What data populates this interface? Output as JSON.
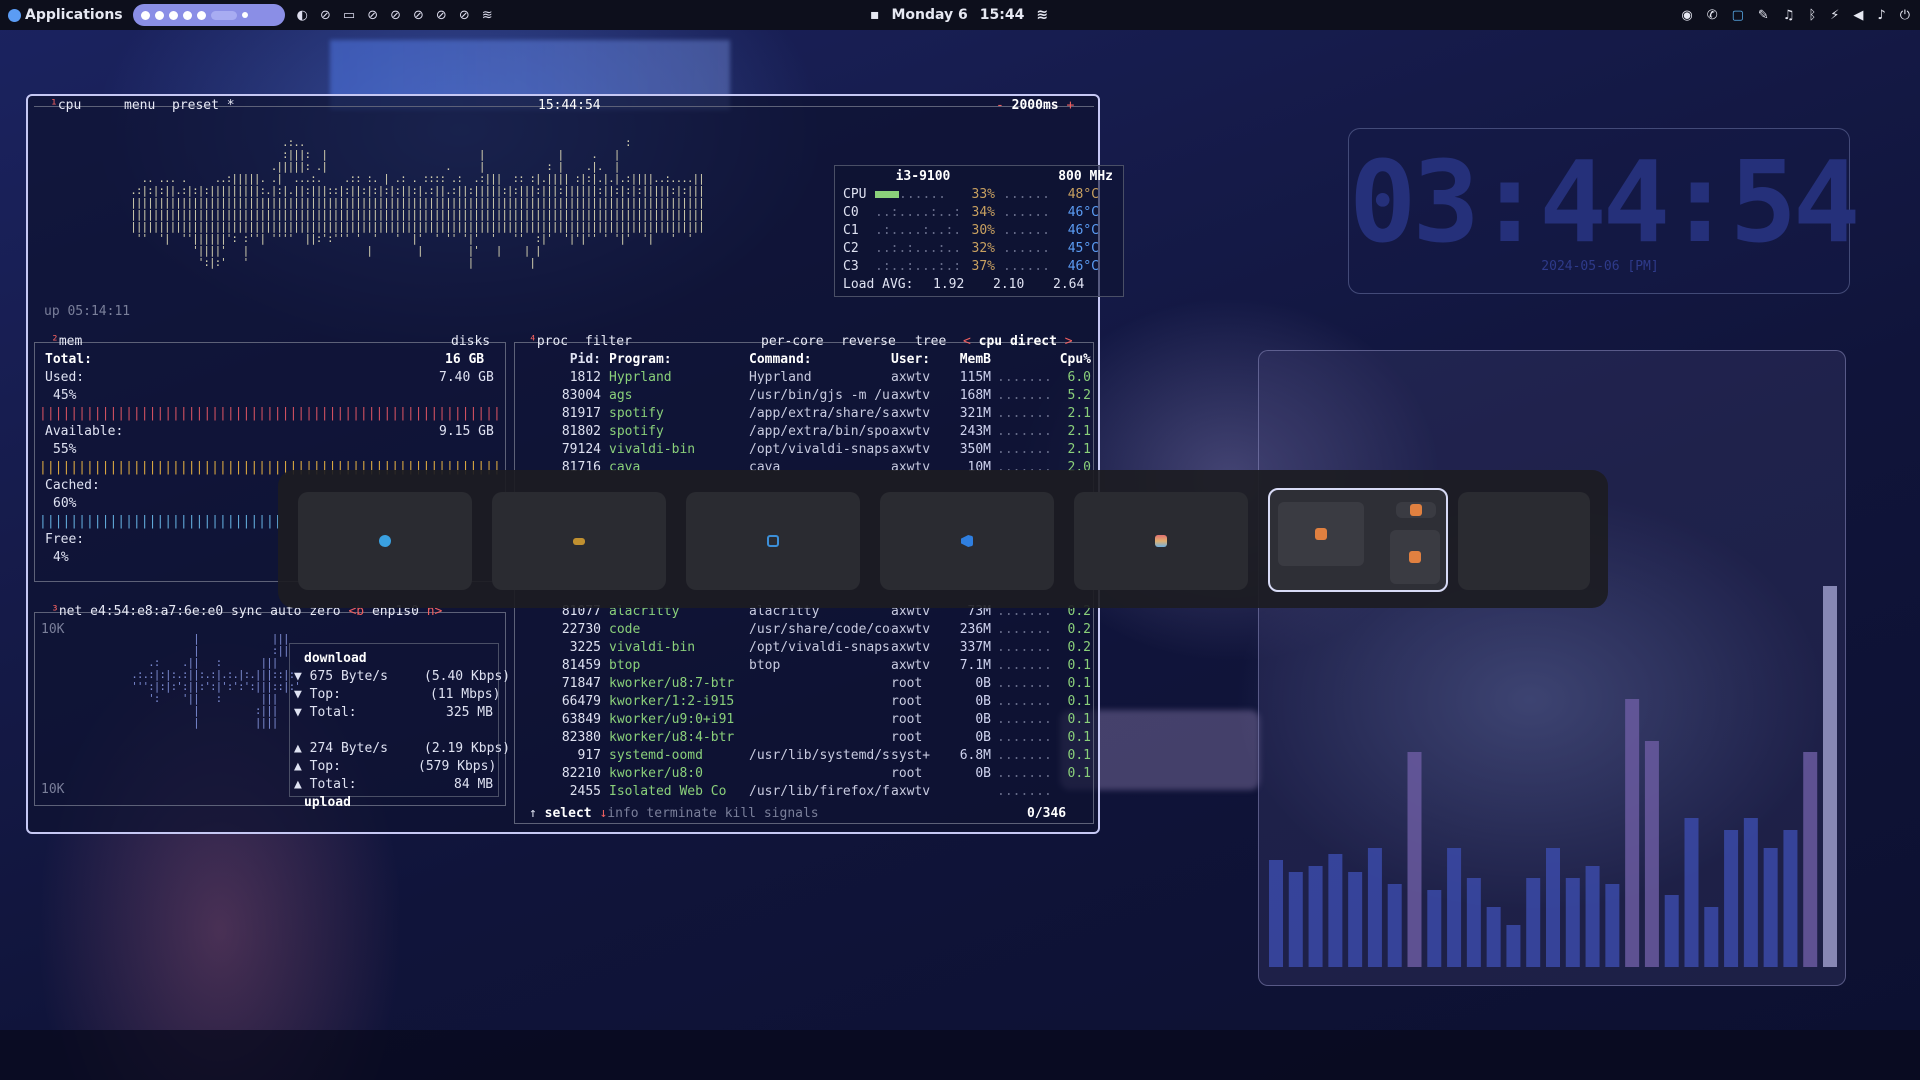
{
  "topbar": {
    "apps_label": "Applications",
    "date": "Monday  6",
    "time": "15:44"
  },
  "btop": {
    "cpu_title": "cpu",
    "cpu_num": "¹",
    "menu": "menu",
    "preset": "preset *",
    "clock": "15:44:54",
    "interval": "2000ms",
    "interval_minus": "-",
    "interval_plus": "+",
    "uptime": "up 05:14:11",
    "cpu_model": "i3-9100",
    "cpu_freq": "800 MHz",
    "cores": [
      {
        "name": "CPU",
        "pct": "33%",
        "temp": "48°C"
      },
      {
        "name": "C0",
        "pct": "34%",
        "temp": "46°C"
      },
      {
        "name": "C1",
        "pct": "30%",
        "temp": "46°C"
      },
      {
        "name": "C2",
        "pct": "32%",
        "temp": "45°C"
      },
      {
        "name": "C3",
        "pct": "37%",
        "temp": "46°C"
      }
    ],
    "load_label": "Load AVG:",
    "load": [
      "1.92",
      "2.10",
      "2.64"
    ],
    "mem_title": "mem",
    "mem_num": "²",
    "disks": "disks",
    "mem_total_label": "Total:",
    "mem_total": "16 GB",
    "mem_used_label": "Used:",
    "mem_used": "7.40 GB",
    "mem_used_pct": "45%",
    "mem_avail_label": "Available:",
    "mem_avail": "9.15 GB",
    "mem_avail_pct": "55%",
    "mem_cached_label": "Cached:",
    "mem_cached_pct": "60%",
    "mem_free_label": "Free:",
    "mem_free_pct": "4%",
    "net_title": "net",
    "net_num": "³",
    "net_mac": "e4:54:e8:a7:6e:e0",
    "net_sync": "sync",
    "net_auto": "auto",
    "net_zero": "zero",
    "net_b": "<b",
    "net_iface": "enp1s0",
    "net_n": "n>",
    "net_scale_top": "10K",
    "net_scale_bottom": "10K",
    "download_label": "download",
    "dl_rate": "675 Byte/s",
    "dl_rate_bits": "(5.40 Kbps)",
    "dl_top_label": "Top:",
    "dl_top": "(11 Mbps)",
    "dl_total_label": "Total:",
    "dl_total": "325 MB",
    "ul_rate": "274 Byte/s",
    "ul_rate_bits": "(2.19 Kbps)",
    "ul_top_label": "Top:",
    "ul_top": "(579 Kbps)",
    "ul_total_label": "Total:",
    "ul_total": "84 MB",
    "upload_label": "upload",
    "proc_title": "proc",
    "proc_num": "⁴",
    "filter": "filter",
    "per_core": "per-core",
    "reverse": "reverse",
    "tree": "tree",
    "sort_prev": "<",
    "sort_label": "cpu direct",
    "sort_next": ">",
    "col_pid": "Pid:",
    "col_program": "Program:",
    "col_command": "Command:",
    "col_user": "User:",
    "col_mem": "MemB",
    "col_cpu": "Cpu%",
    "procs_top": [
      {
        "pid": "1812",
        "program": "Hyprland",
        "command": "Hyprland",
        "user": "axwtv",
        "mem": "115M",
        "cpu": "6.0"
      },
      {
        "pid": "83004",
        "program": "ags",
        "command": "/usr/bin/gjs -m /usr",
        "user": "axwtv",
        "mem": "168M",
        "cpu": "5.2"
      },
      {
        "pid": "81917",
        "program": "spotify",
        "command": "/app/extra/share/spo",
        "user": "axwtv",
        "mem": "321M",
        "cpu": "2.1"
      },
      {
        "pid": "81802",
        "program": "spotify",
        "command": "/app/extra/bin/spoti",
        "user": "axwtv",
        "mem": "243M",
        "cpu": "2.1"
      },
      {
        "pid": "79124",
        "program": "vivaldi-bin",
        "command": "/opt/vivaldi-snapsho",
        "user": "axwtv",
        "mem": "350M",
        "cpu": "2.1"
      },
      {
        "pid": "81716",
        "program": "cava",
        "command": "cava",
        "user": "axwtv",
        "mem": "10M",
        "cpu": "2.0"
      }
    ],
    "procs_bottom": [
      {
        "pid": "81077",
        "program": "alacritty",
        "command": "alacritty",
        "user": "axwtv",
        "mem": "73M",
        "cpu": "0.2"
      },
      {
        "pid": "22730",
        "program": "code",
        "command": "/usr/share/code/code",
        "user": "axwtv",
        "mem": "236M",
        "cpu": "0.2"
      },
      {
        "pid": "3225",
        "program": "vivaldi-bin",
        "command": "/opt/vivaldi-snapsho",
        "user": "axwtv",
        "mem": "337M",
        "cpu": "0.2"
      },
      {
        "pid": "81459",
        "program": "btop",
        "command": "btop",
        "user": "axwtv",
        "mem": "7.1M",
        "cpu": "0.1"
      },
      {
        "pid": "71847",
        "program": "kworker/u8:7-btr",
        "command": "",
        "user": "root",
        "mem": "0B",
        "cpu": "0.1"
      },
      {
        "pid": "66479",
        "program": "kworker/1:2-i915",
        "command": "",
        "user": "root",
        "mem": "0B",
        "cpu": "0.1"
      },
      {
        "pid": "63849",
        "program": "kworker/u9:0+i91",
        "command": "",
        "user": "root",
        "mem": "0B",
        "cpu": "0.1"
      },
      {
        "pid": "82380",
        "program": "kworker/u8:4-btr",
        "command": "",
        "user": "root",
        "mem": "0B",
        "cpu": "0.1"
      },
      {
        "pid": "917",
        "program": "systemd-oomd",
        "command": "/usr/lib/systemd/sys",
        "user": "syst+",
        "mem": "6.8M",
        "cpu": "0.1"
      },
      {
        "pid": "82210",
        "program": "kworker/u8:0",
        "command": "",
        "user": "root",
        "mem": "0B",
        "cpu": "0.1"
      },
      {
        "pid": "2455",
        "program": "Isolated Web Co",
        "command": "/usr/lib/firefox/fir",
        "user": "axwtv",
        "mem": "",
        "cpu": ""
      }
    ],
    "select_label": "select",
    "info_label": "info",
    "terminate_label": "terminate",
    "kill_label": "kill",
    "signals_label": "signals",
    "proc_count": "0/346"
  },
  "clock_widget": {
    "time": "03:44:54",
    "date": "2024-05-06 [PM]"
  },
  "visualizer": {
    "levels": [
      0.18,
      0.16,
      0.17,
      0.19,
      0.16,
      0.2,
      0.14,
      0.36,
      0.13,
      0.2,
      0.15,
      0.1,
      0.07,
      0.15,
      0.2,
      0.15,
      0.17,
      0.14,
      0.45,
      0.38,
      0.12,
      0.25,
      0.1,
      0.23,
      0.25,
      0.2,
      0.23,
      0.36,
      0.64
    ]
  },
  "overview": {
    "workspaces": [
      {
        "icon": "firefox-icon",
        "color": "#3aa0e0"
      },
      {
        "icon": "terminal-icon",
        "color": "#c09030"
      },
      {
        "icon": "folder-icon",
        "color": "#3c8fd8"
      },
      {
        "icon": "vscode-icon",
        "color": "#2f7fe0"
      },
      {
        "icon": "spotify-icon",
        "color": "#e07070"
      },
      {
        "icon": "alacritty-icon",
        "color": "#e08040"
      },
      {
        "icon": "empty",
        "color": "#2a2b31"
      }
    ]
  },
  "colors": {
    "accent": "#8a8ee6",
    "border": "#c6c8f4",
    "proc_green": "#8ad07a",
    "clock_blue": "#25307a"
  }
}
